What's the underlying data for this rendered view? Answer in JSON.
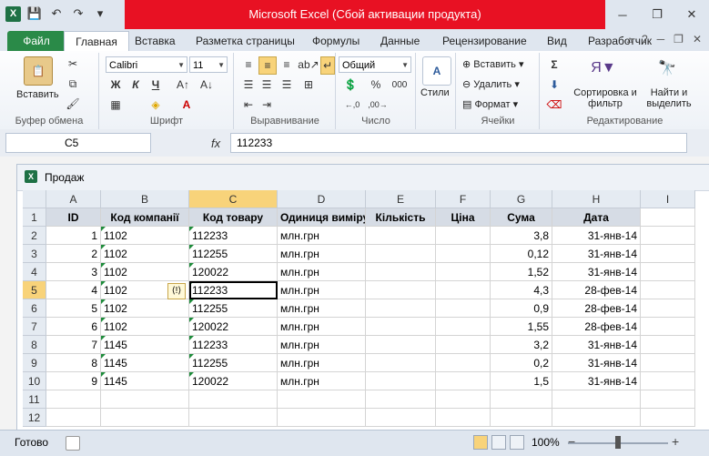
{
  "window": {
    "title": "Microsoft Excel (Сбой активации продукта)"
  },
  "qat": {
    "app_icon": "X",
    "save": "💾",
    "undo": "↶",
    "redo": "↷",
    "customize": "▾"
  },
  "window_buttons": {
    "minimize": "─",
    "restore": "❐",
    "close": "✕"
  },
  "ribbon_tabs": [
    "Файл",
    "Главная",
    "Вставка",
    "Разметка страницы",
    "Формулы",
    "Данные",
    "Рецензирование",
    "Вид",
    "Разработчик"
  ],
  "ribbon": {
    "paste": "Вставить",
    "font_name": "Calibri",
    "font_size": "11",
    "number_format": "Общий",
    "styles": "Стили",
    "insert": "Вставить",
    "delete": "Удалить",
    "format": "Формат",
    "sort_filter": "Сортировка и фильтр",
    "find_select": "Найти и выделить",
    "bold": "Ж",
    "italic": "К",
    "underline": "Ч",
    "sigma": "Σ",
    "percent": "%",
    "thousands": "000",
    "groups": {
      "clipboard": "Буфер обмена",
      "font": "Шрифт",
      "alignment": "Выравнивание",
      "number": "Число",
      "cells": "Ячейки",
      "editing": "Редактирование"
    }
  },
  "formula_bar": {
    "name_box": "C5",
    "fx": "fx",
    "value": "112233"
  },
  "workbook": {
    "title": "Продаж"
  },
  "columns": [
    "A",
    "B",
    "C",
    "D",
    "E",
    "F",
    "G",
    "H",
    "I"
  ],
  "rows": [
    "1",
    "2",
    "3",
    "4",
    "5",
    "6",
    "7",
    "8",
    "9",
    "10",
    "11",
    "12"
  ],
  "table": {
    "headers": [
      "ID",
      "Код компанії",
      "Код товару",
      "Одиниця виміру",
      "Кількість",
      "Ціна",
      "Сума",
      "Дата"
    ],
    "rows": [
      [
        "1",
        "1102",
        "112233",
        "млн.грн",
        "",
        "",
        "3,8",
        "31-янв-14"
      ],
      [
        "2",
        "1102",
        "112255",
        "млн.грн",
        "",
        "",
        "0,12",
        "31-янв-14"
      ],
      [
        "3",
        "1102",
        "120022",
        "млн.грн",
        "",
        "",
        "1,52",
        "31-янв-14"
      ],
      [
        "4",
        "1102",
        "112233",
        "млн.грн",
        "",
        "",
        "4,3",
        "28-фев-14"
      ],
      [
        "5",
        "1102",
        "112255",
        "млн.грн",
        "",
        "",
        "0,9",
        "28-фев-14"
      ],
      [
        "6",
        "1102",
        "120022",
        "млн.грн",
        "",
        "",
        "1,55",
        "28-фев-14"
      ],
      [
        "7",
        "1145",
        "112233",
        "млн.грн",
        "",
        "",
        "3,2",
        "31-янв-14"
      ],
      [
        "8",
        "1145",
        "112255",
        "млн.грн",
        "",
        "",
        "0,2",
        "31-янв-14"
      ],
      [
        "9",
        "1145",
        "120022",
        "млн.грн",
        "",
        "",
        "1,5",
        "31-янв-14"
      ]
    ]
  },
  "status_bar": {
    "ready": "Готово",
    "zoom": "100%"
  }
}
